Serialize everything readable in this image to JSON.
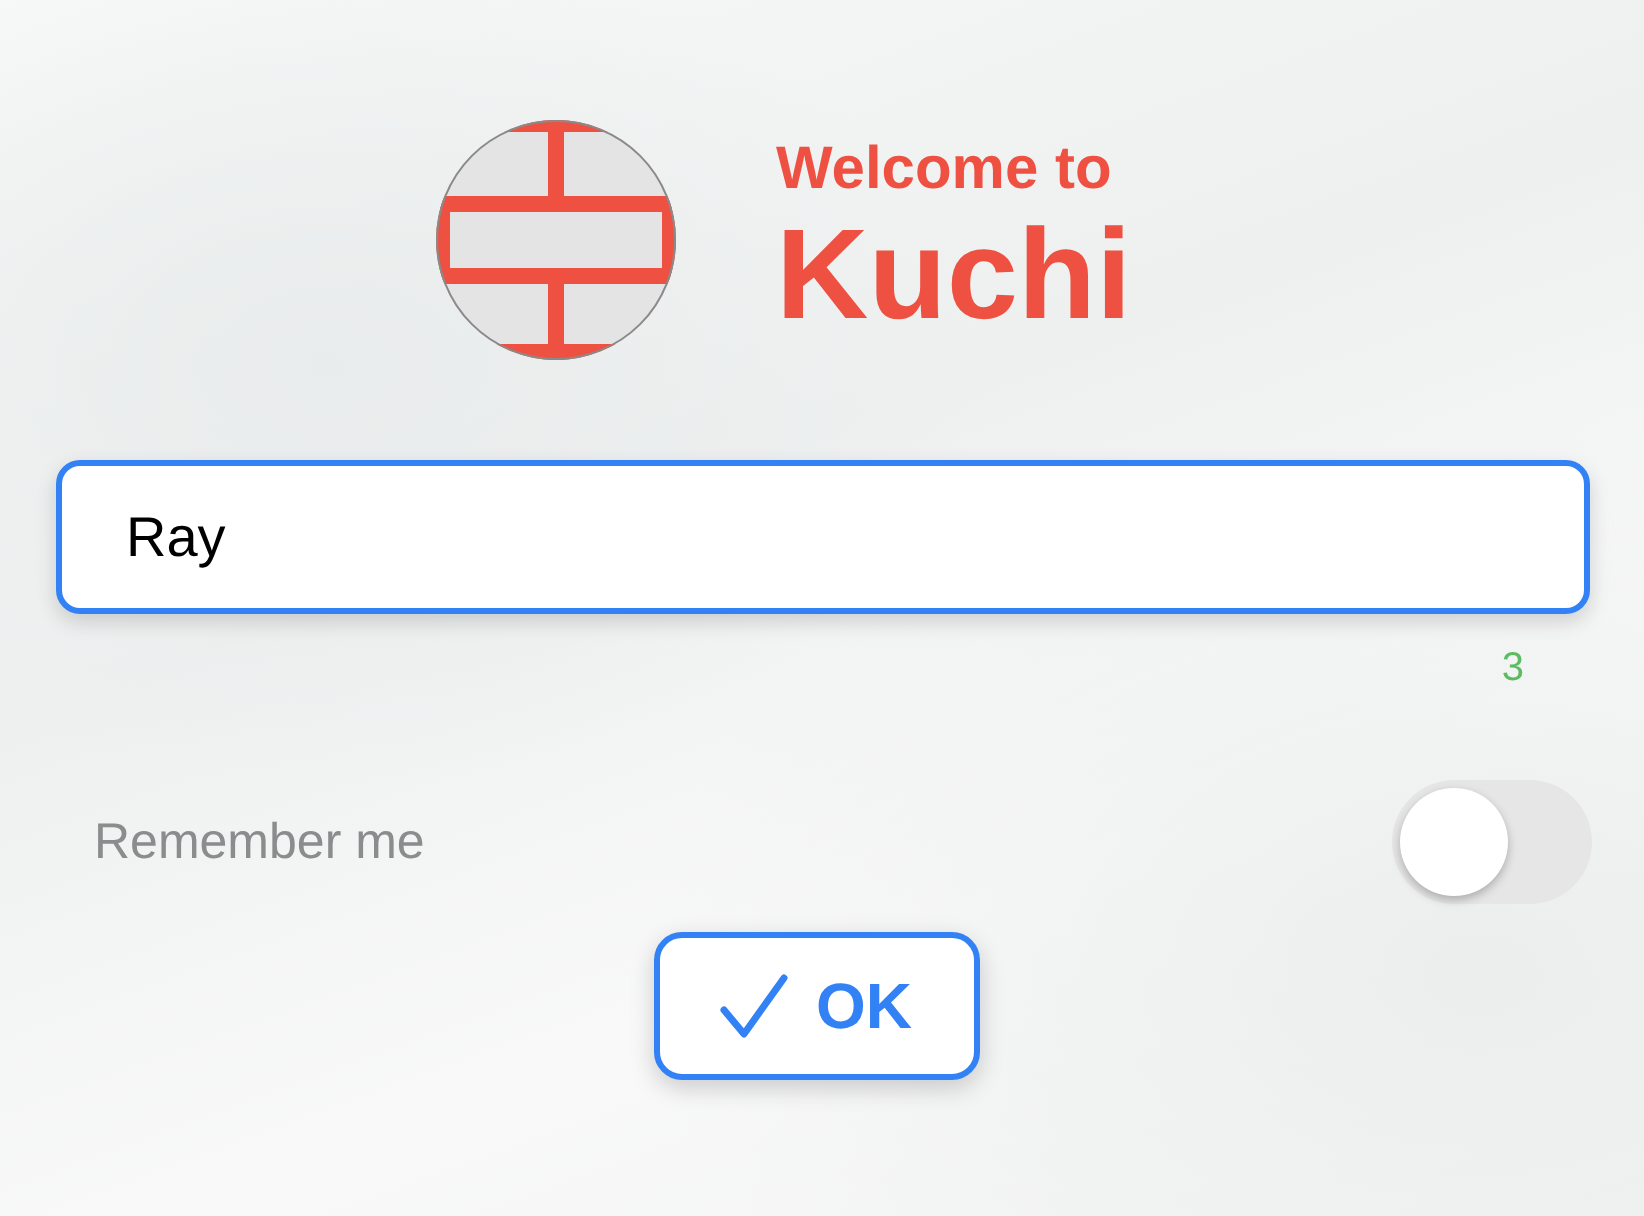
{
  "header": {
    "greeting": "Welcome to",
    "app_name": "Kuchi"
  },
  "name_field": {
    "value": "Ray",
    "counter": "3"
  },
  "remember": {
    "label": "Remember me",
    "on": false
  },
  "ok_button": {
    "label": "OK"
  }
}
